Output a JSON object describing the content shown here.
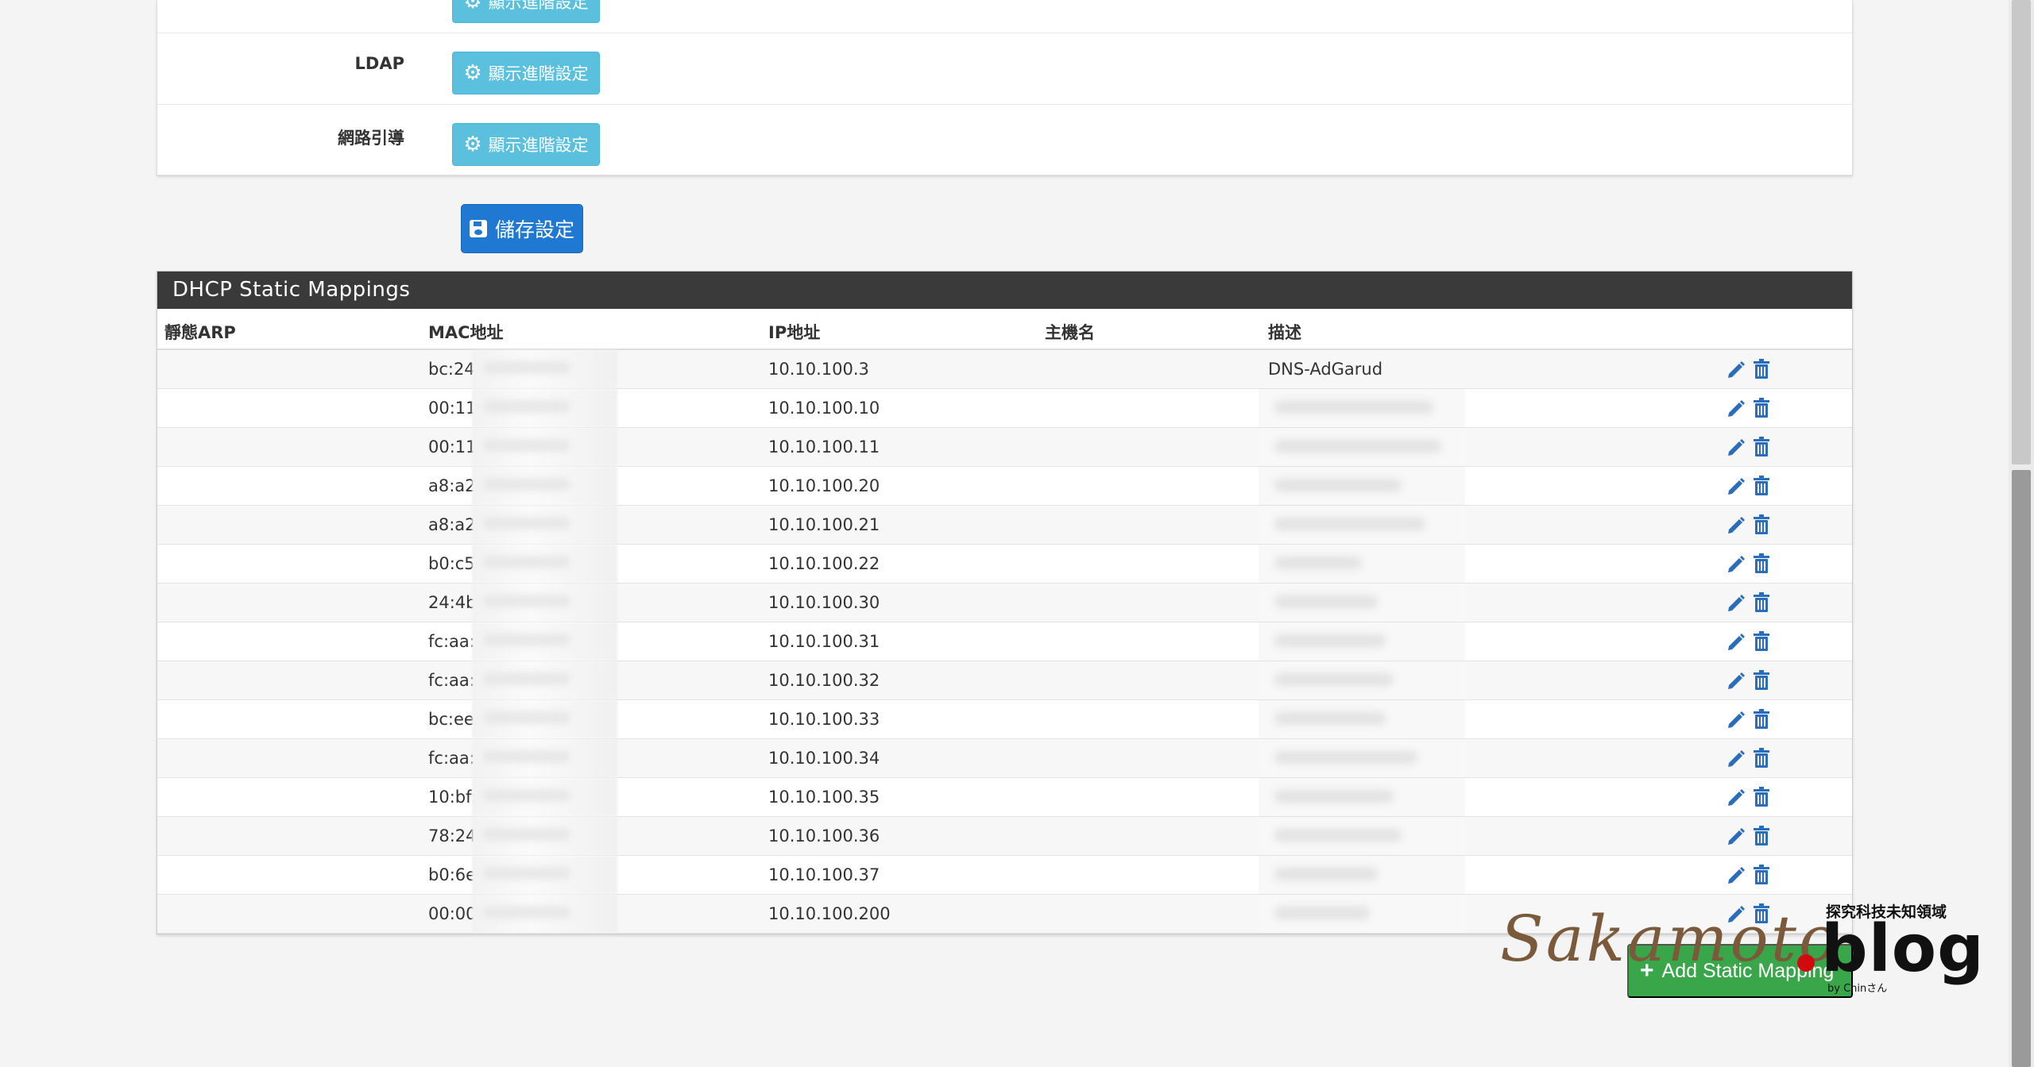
{
  "settings": {
    "rows": [
      {
        "label": "",
        "button": "顯示進階設定"
      },
      {
        "label": "LDAP",
        "button": "顯示進階設定"
      },
      {
        "label": "網路引導",
        "button": "顯示進階設定"
      }
    ],
    "save_label": "儲存設定"
  },
  "dhcp": {
    "title": "DHCP Static Mappings",
    "columns": [
      "靜態ARP",
      "MAC地址",
      "IP地址",
      "主機名",
      "描述"
    ],
    "rows": [
      {
        "mac": "bc:24",
        "ip": "10.10.100.3",
        "desc": "DNS-AdGarud"
      },
      {
        "mac": "00:11",
        "ip": "10.10.100.10",
        "desc": ""
      },
      {
        "mac": "00:11",
        "ip": "10.10.100.11",
        "desc": ""
      },
      {
        "mac": "a8:a2",
        "ip": "10.10.100.20",
        "desc": ""
      },
      {
        "mac": "a8:a2",
        "ip": "10.10.100.21",
        "desc": ""
      },
      {
        "mac": "b0:c5",
        "ip": "10.10.100.22",
        "desc": ""
      },
      {
        "mac": "24:4b",
        "ip": "10.10.100.30",
        "desc": ""
      },
      {
        "mac": "fc:aa:",
        "ip": "10.10.100.31",
        "desc": ""
      },
      {
        "mac": "fc:aa:",
        "ip": "10.10.100.32",
        "desc": ""
      },
      {
        "mac": "bc:ee",
        "ip": "10.10.100.33",
        "desc": ""
      },
      {
        "mac": "fc:aa:",
        "ip": "10.10.100.34",
        "desc": ""
      },
      {
        "mac": "10:bf:",
        "ip": "10.10.100.35",
        "desc": ""
      },
      {
        "mac": "78:24",
        "ip": "10.10.100.36",
        "desc": ""
      },
      {
        "mac": "b0:6e",
        "ip": "10.10.100.37",
        "desc": ""
      },
      {
        "mac": "00:00",
        "ip": "10.10.100.200",
        "desc": ""
      }
    ],
    "add_label": "Add Static Mapping"
  },
  "watermark": {
    "script": "Sakamoto",
    "blog": "blog",
    "tagline": "探究科技未知領域",
    "by": "by Chinさん"
  },
  "colors": {
    "info_button": "#5bc0de",
    "primary_button": "#1f78d1",
    "success_button": "#3aa64a",
    "panel_header": "#3a3a3a",
    "icon_blue": "#2a6ebb"
  },
  "icons": {
    "advanced": "gear-icon",
    "save": "floppy-icon",
    "edit": "pencil-icon",
    "delete": "trash-icon",
    "add": "plus-icon"
  }
}
